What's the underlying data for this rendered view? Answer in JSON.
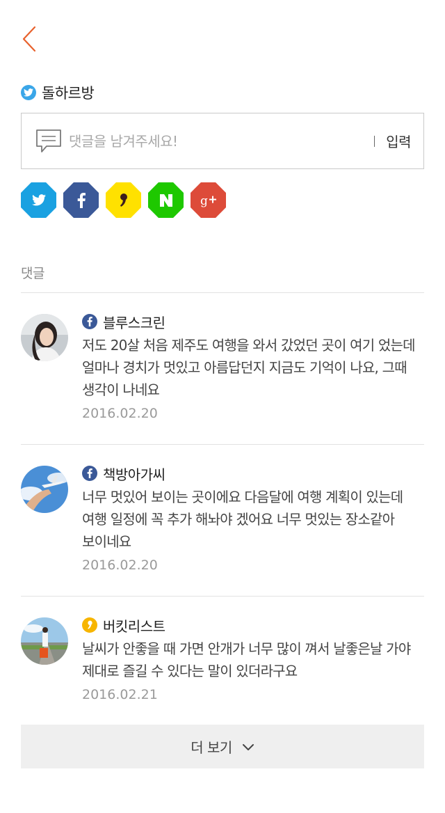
{
  "nav": {
    "back_icon": "chevron-left-icon",
    "accent_color": "#e8612c"
  },
  "user": {
    "name": "돌하르방",
    "sns": "twitter"
  },
  "comment_form": {
    "placeholder": "댓글을 남겨주세요!",
    "value": "",
    "submit_label": "입력",
    "icon": "speech-bubble-icon"
  },
  "share": [
    {
      "name": "twitter",
      "icon": "twitter-icon",
      "color": "#1aa1e1"
    },
    {
      "name": "facebook",
      "icon": "facebook-icon",
      "color": "#3b5998"
    },
    {
      "name": "kakaostory",
      "icon": "kakaostory-icon",
      "color": "#ffe100"
    },
    {
      "name": "naver",
      "icon": "naver-icon",
      "color": "#1ec800"
    },
    {
      "name": "googleplus",
      "icon": "google-plus-icon",
      "color": "#dd4b39"
    }
  ],
  "comments_section": {
    "title": "댓글",
    "items": [
      {
        "author": "블루스크린",
        "sns": "facebook",
        "text": "저도 20살 처음 제주도 여행을 와서 갔었던 곳이 여기 었는데 얼마나 경치가 멋있고 아름답던지 지금도 기억이 나요, 그때 생각이 나네요",
        "date": "2016.02.20"
      },
      {
        "author": "책방아가씨",
        "sns": "facebook",
        "text": "너무 멋있어 보이는 곳이에요 다음달에 여행 계획이 있는데 여행 일정에 꼭 추가 해놔야 겠어요 너무 멋있는 장소같아 보이네요",
        "date": "2016.02.20"
      },
      {
        "author": "버킷리스트",
        "sns": "kakaostory",
        "text": "날씨가 안좋을 때 가면 안개가 너무 많이 껴서 날좋은날 가야 제대로 즐길 수 있다는 말이 있더라구요",
        "date": "2016.02.21"
      }
    ]
  },
  "more": {
    "label": "더 보기",
    "icon": "chevron-down-icon"
  }
}
